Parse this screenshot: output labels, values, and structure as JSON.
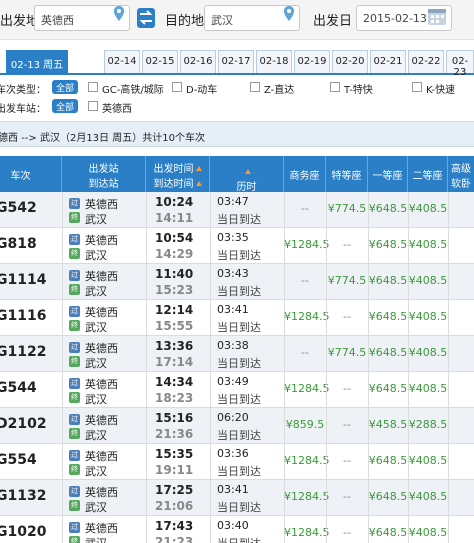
{
  "search": {
    "from_label": "出发地",
    "from_value": "英德西",
    "to_label": "目的地",
    "to_value": "武汉",
    "date_label": "出发日",
    "date_value": "2015-02-13"
  },
  "date_tabs": [
    "02-13 周五",
    "02-14",
    "02-15",
    "02-16",
    "02-17",
    "02-18",
    "02-19",
    "02-20",
    "02-21",
    "02-22",
    "02-23"
  ],
  "filters": {
    "type_label": "车次类型：",
    "type_all": "全部",
    "types": [
      "GC-高铁/城际",
      "D-动车",
      "Z-直达",
      "T-特快",
      "K-快速"
    ],
    "station_label": "出发车站：",
    "station_all": "全部",
    "stations": [
      "英德西"
    ]
  },
  "summary": "英德西 --> 武汉（2月13日 周五）共计10个车次",
  "table": {
    "headers": {
      "train": "车次",
      "station_from": "出发站",
      "station_to": "到达站",
      "dep_time": "出发时间",
      "arr_time": "到达时间",
      "duration": "历时",
      "business": "商务座",
      "special": "特等座",
      "first": "一等座",
      "second": "二等座",
      "soft_sleeper_1": "高级",
      "soft_sleeper_2": "软卧"
    },
    "badges": {
      "start": "始",
      "pass": "过",
      "end": "终"
    },
    "rows": [
      {
        "train": "G542",
        "from": "英德西",
        "to": "武汉",
        "dep": "10:24",
        "arr": "14:11",
        "dur": "03:47",
        "day": "当日到达",
        "business": "--",
        "special": "¥774.5",
        "first": "¥648.5",
        "second": "¥408.5",
        "from_badge": "pass"
      },
      {
        "train": "G818",
        "from": "英德西",
        "to": "武汉",
        "dep": "10:54",
        "arr": "14:29",
        "dur": "03:35",
        "day": "当日到达",
        "business": "¥1284.5",
        "special": "--",
        "first": "¥648.5",
        "second": "¥408.5",
        "from_badge": "pass"
      },
      {
        "train": "G1114",
        "from": "英德西",
        "to": "武汉",
        "dep": "11:40",
        "arr": "15:23",
        "dur": "03:43",
        "day": "当日到达",
        "business": "--",
        "special": "¥774.5",
        "first": "¥648.5",
        "second": "¥408.5",
        "from_badge": "pass"
      },
      {
        "train": "G1116",
        "from": "英德西",
        "to": "武汉",
        "dep": "12:14",
        "arr": "15:55",
        "dur": "03:41",
        "day": "当日到达",
        "business": "¥1284.5",
        "special": "--",
        "first": "¥648.5",
        "second": "¥408.5",
        "from_badge": "pass"
      },
      {
        "train": "G1122",
        "from": "英德西",
        "to": "武汉",
        "dep": "13:36",
        "arr": "17:14",
        "dur": "03:38",
        "day": "当日到达",
        "business": "--",
        "special": "¥774.5",
        "first": "¥648.5",
        "second": "¥408.5",
        "from_badge": "pass"
      },
      {
        "train": "G544",
        "from": "英德西",
        "to": "武汉",
        "dep": "14:34",
        "arr": "18:23",
        "dur": "03:49",
        "day": "当日到达",
        "business": "¥1284.5",
        "special": "--",
        "first": "¥648.5",
        "second": "¥408.5",
        "from_badge": "pass"
      },
      {
        "train": "D2102",
        "from": "英德西",
        "to": "武汉",
        "dep": "15:16",
        "arr": "21:36",
        "dur": "06:20",
        "day": "当日到达",
        "business": "¥859.5",
        "special": "--",
        "first": "¥458.5",
        "second": "¥288.5",
        "from_badge": "pass"
      },
      {
        "train": "G554",
        "from": "英德西",
        "to": "武汉",
        "dep": "15:35",
        "arr": "19:11",
        "dur": "03:36",
        "day": "当日到达",
        "business": "¥1284.5",
        "special": "--",
        "first": "¥648.5",
        "second": "¥408.5",
        "from_badge": "pass"
      },
      {
        "train": "G1132",
        "from": "英德西",
        "to": "武汉",
        "dep": "17:25",
        "arr": "21:06",
        "dur": "03:41",
        "day": "当日到达",
        "business": "¥1284.5",
        "special": "--",
        "first": "¥648.5",
        "second": "¥408.5",
        "from_badge": "pass"
      },
      {
        "train": "G1020",
        "from": "英德西",
        "to": "武汉",
        "dep": "17:43",
        "arr": "21:23",
        "dur": "03:40",
        "day": "当日到达",
        "business": "¥1284.5",
        "special": "--",
        "first": "¥648.5",
        "second": "¥408.5",
        "from_badge": "pass"
      }
    ]
  },
  "colors": {
    "accent": "#2b7fc6",
    "price_green": "#3a9a3a",
    "sort_arrow": "#f39c38",
    "row_alt": "#eef2f6"
  }
}
